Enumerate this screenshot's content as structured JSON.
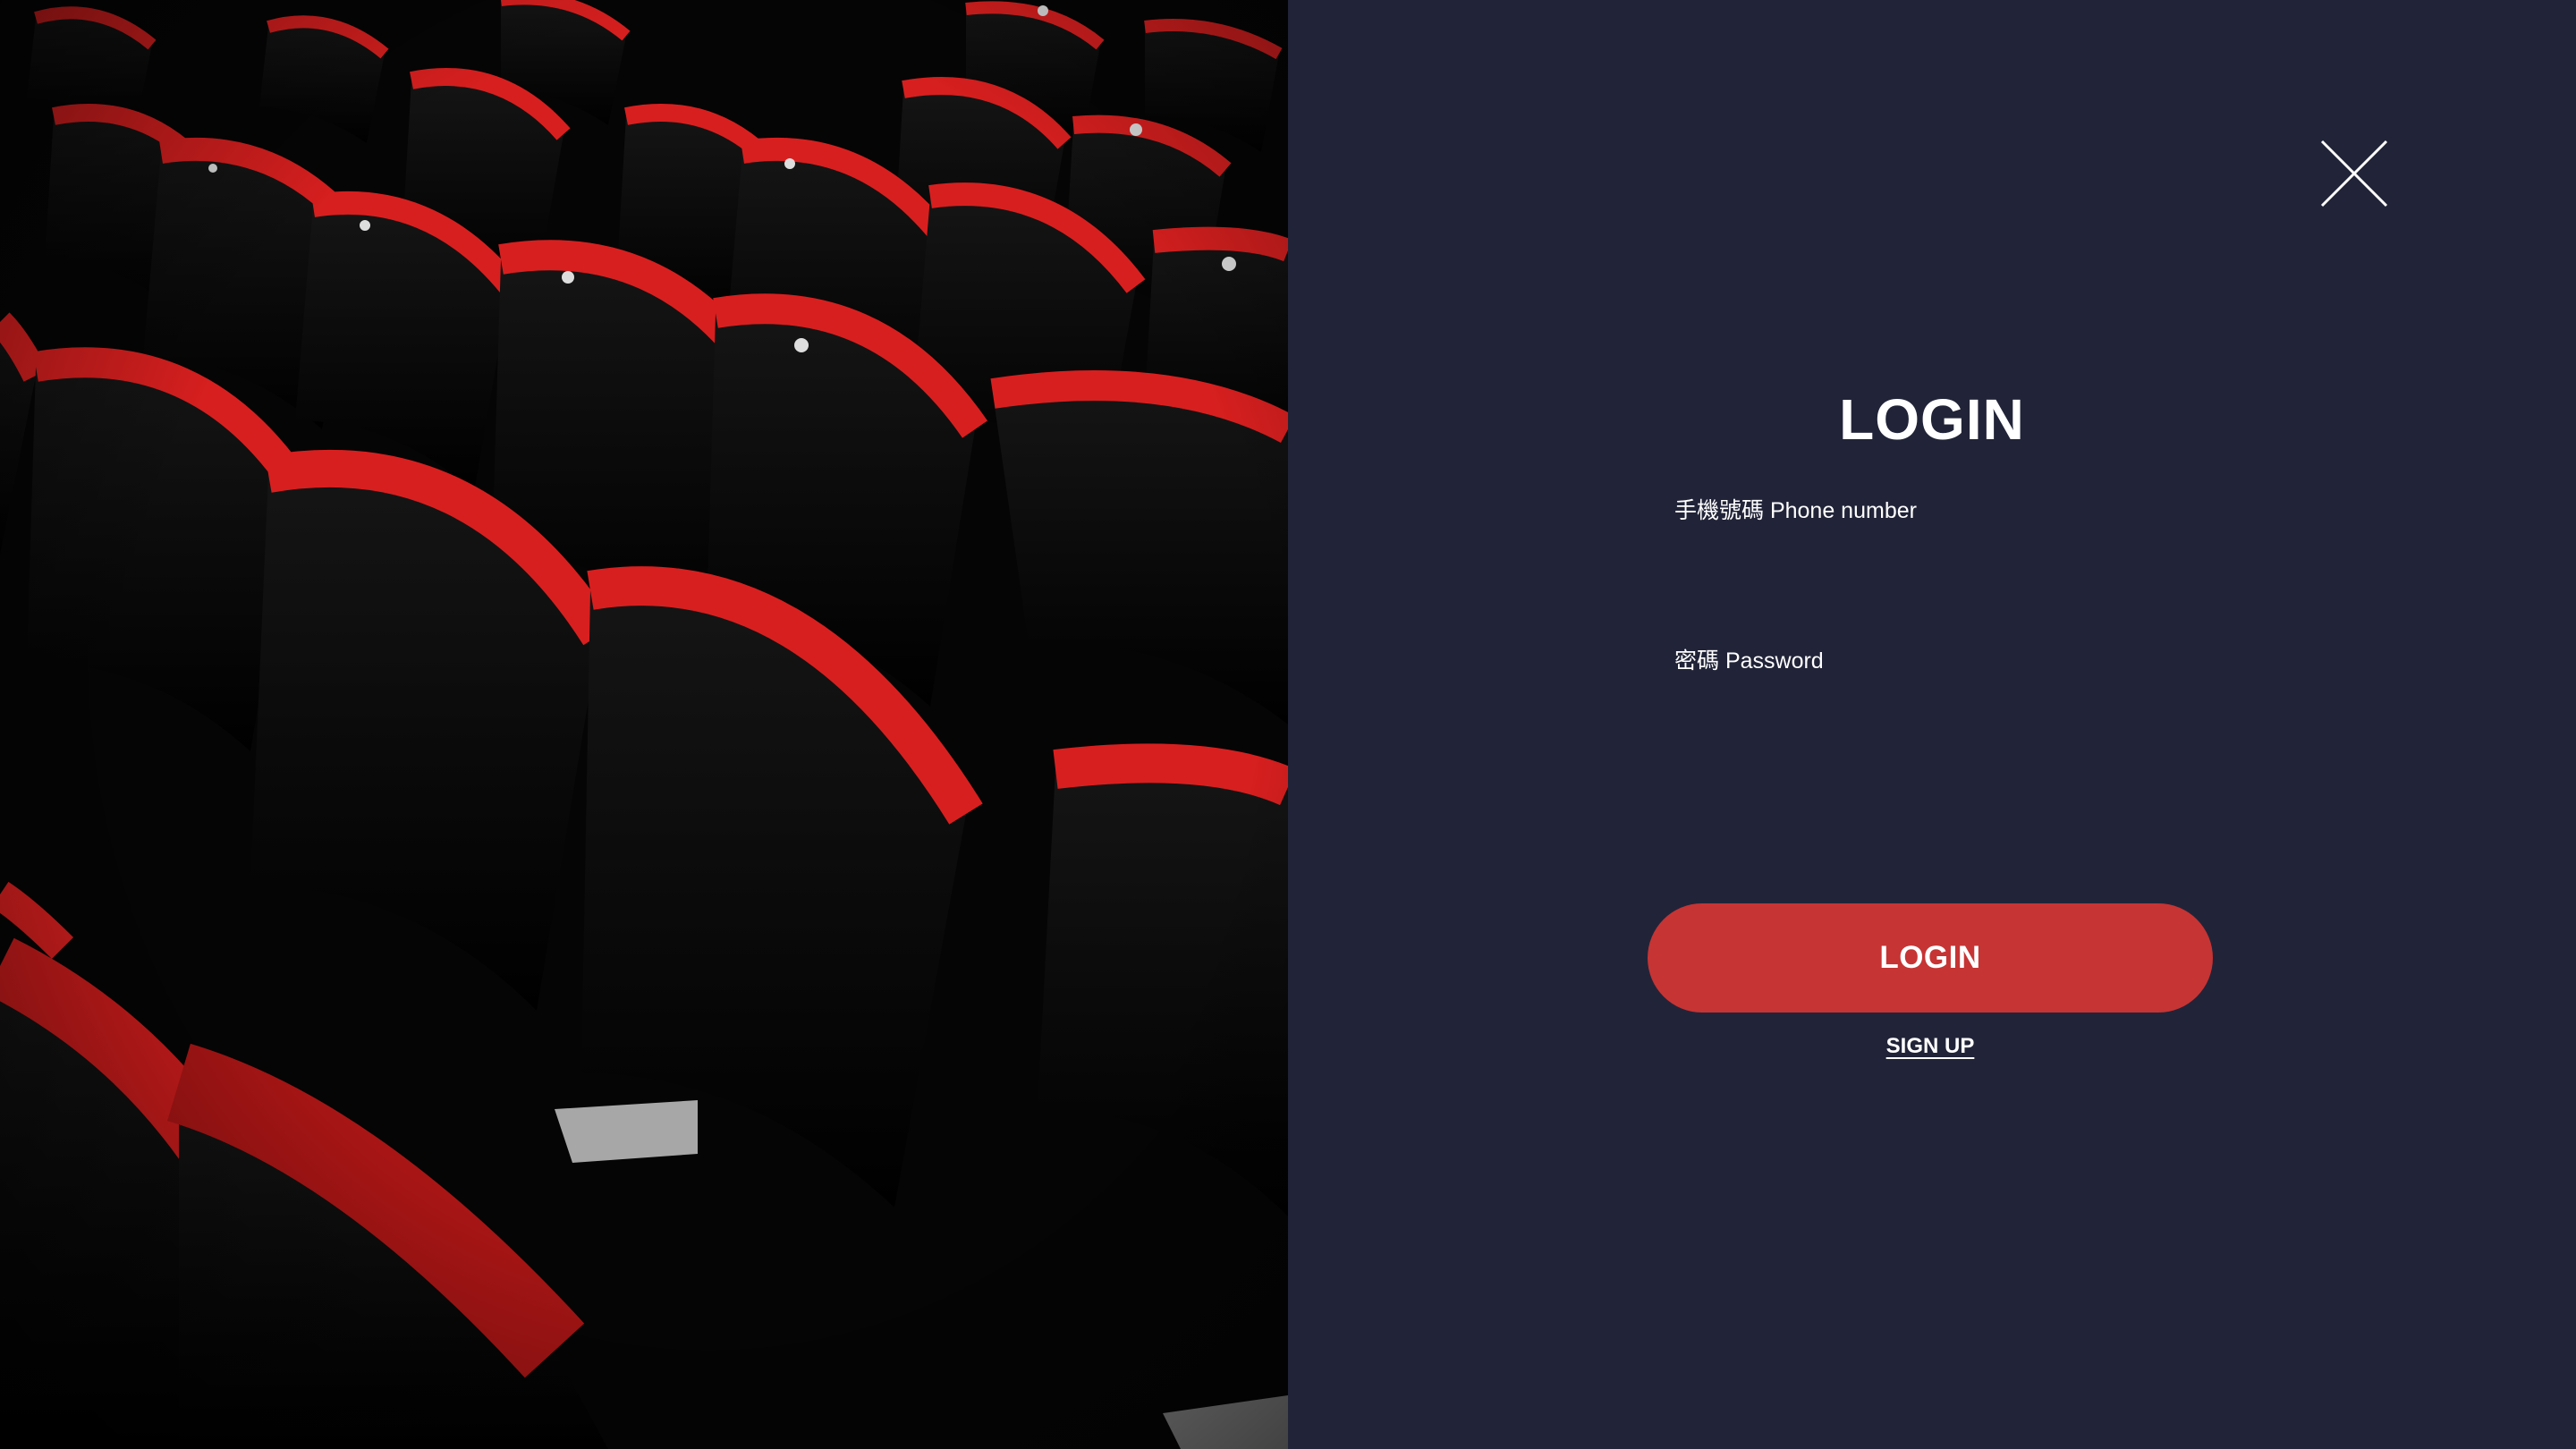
{
  "hero": {
    "image_icon": "theater-seats-photo",
    "seat_color": "#d81f1f",
    "background_color": "#000000"
  },
  "login_panel": {
    "background_color": "#212438",
    "close_icon": "close-icon",
    "title": "LOGIN",
    "phone_label": "手機號碼 Phone number",
    "phone_value": "",
    "password_label": "密碼 Password",
    "password_value": "",
    "login_button_label": "LOGIN",
    "login_button_color": "#c63434",
    "signup_label": "SIGN UP"
  }
}
